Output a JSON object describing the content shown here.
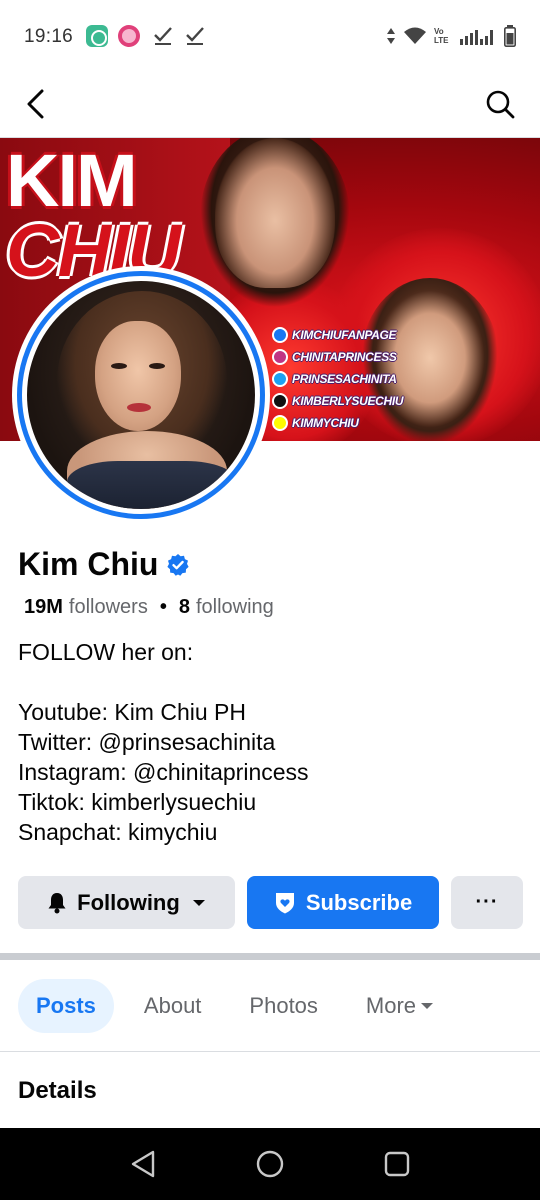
{
  "status_bar": {
    "time": "19:16",
    "network_label": "Vo LTE"
  },
  "cover": {
    "title_line1": "KIM",
    "title_line2": "CHIU",
    "socials": [
      {
        "label": "KIMCHIUFANPAGE",
        "icon": "facebook-icon",
        "color": "#1877f2"
      },
      {
        "label": "CHINITAPRINCESS",
        "icon": "instagram-icon",
        "color": "#c13584"
      },
      {
        "label": "PRINSESACHINITA",
        "icon": "twitter-icon",
        "color": "#1da1f2"
      },
      {
        "label": "KIMBERLYSUECHIU",
        "icon": "tiktok-icon",
        "color": "#111111"
      },
      {
        "label": "KIMMYCHIU",
        "icon": "snapchat-icon",
        "color": "#fffc00"
      }
    ]
  },
  "profile": {
    "name": "Kim Chiu",
    "verified": true,
    "followers_count": "19M",
    "followers_label": "followers",
    "following_count": "8",
    "following_label": "following",
    "bio_intro": "FOLLOW her on:",
    "bio_lines": [
      "Youtube: Kim Chiu PH",
      "Twitter: @prinsesachinita",
      "Instagram: @chinitaprincess",
      "Tiktok: kimberlysuechiu",
      "Snapchat: kimychiu"
    ]
  },
  "actions": {
    "following_label": "Following",
    "subscribe_label": "Subscribe",
    "more_label": "···"
  },
  "tabs": [
    {
      "label": "Posts",
      "active": true
    },
    {
      "label": "About",
      "active": false
    },
    {
      "label": "Photos",
      "active": false
    },
    {
      "label": "More",
      "active": false
    }
  ],
  "section": {
    "details_title": "Details"
  },
  "colors": {
    "accent": "#1877f2",
    "button_grey": "#e4e6eb",
    "text_secondary": "#65676b"
  }
}
